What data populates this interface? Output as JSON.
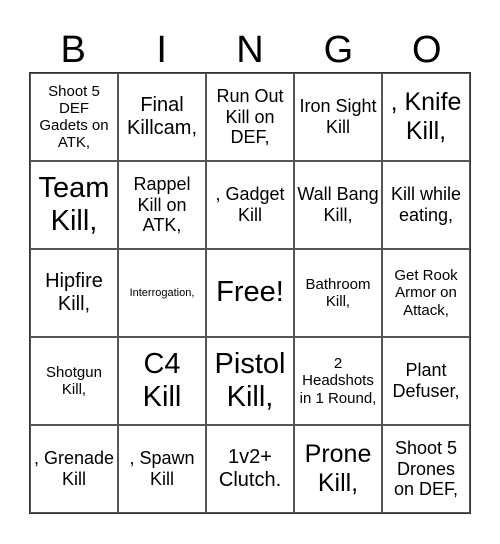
{
  "header": [
    "B",
    "I",
    "N",
    "G",
    "O"
  ],
  "cells": [
    {
      "text": "Shoot 5 DEF Gadets on ATK,",
      "size": "s15"
    },
    {
      "text": "Final Killcam,",
      "size": "s20"
    },
    {
      "text": "Run Out Kill on DEF,",
      "size": "s17"
    },
    {
      "text": "Iron Sight Kill",
      "size": "s17"
    },
    {
      "text": ", Knife Kill,",
      "size": "s24"
    },
    {
      "text": "Team Kill,",
      "size": "s28"
    },
    {
      "text": "Rappel Kill on ATK,",
      "size": "s17"
    },
    {
      "text": ", Gadget Kill",
      "size": "s17"
    },
    {
      "text": "Wall Bang Kill,",
      "size": "s17"
    },
    {
      "text": "Kill while eating,",
      "size": "s17"
    },
    {
      "text": "Hipfire Kill,",
      "size": "s20"
    },
    {
      "text": "Interrogation,",
      "size": "s10"
    },
    {
      "text": "Free!",
      "size": "s28"
    },
    {
      "text": "Bathroom Kill,",
      "size": "s15"
    },
    {
      "text": "Get Rook Armor on Attack,",
      "size": "s15"
    },
    {
      "text": "Shotgun Kill,",
      "size": "s15"
    },
    {
      "text": "C4 Kill",
      "size": "s28"
    },
    {
      "text": "Pistol Kill,",
      "size": "s28"
    },
    {
      "text": "2 Headshots in 1 Round,",
      "size": "s15"
    },
    {
      "text": "Plant Defuser,",
      "size": "s17"
    },
    {
      "text": ", Grenade Kill",
      "size": "s17"
    },
    {
      "text": ", Spawn Kill",
      "size": "s17"
    },
    {
      "text": "1v2+ Clutch.",
      "size": "s20"
    },
    {
      "text": "Prone Kill,",
      "size": "s24"
    },
    {
      "text": "Shoot 5 Drones on DEF,",
      "size": "s17"
    }
  ]
}
